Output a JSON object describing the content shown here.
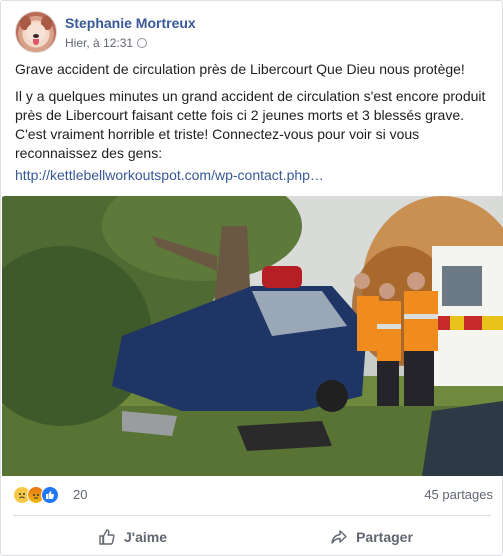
{
  "post": {
    "author": "Stephanie Mortreux",
    "timestamp": "Hier, à 12:31",
    "headline": "Grave accident de circulation près de Libercourt Que Dieu nous protège!",
    "body": "Il y a quelques minutes un grand accident de circulation s'est encore produit près de Libercourt faisant cette fois ci 2 jeunes morts et 3 blessés grave. C'est vraiment horrible et triste! Connectez-vous pour voir si vous reconnaissez des gens:",
    "link": "http://kettlebellworkoutspot.com/wp-contact.php…"
  },
  "stats": {
    "reactions": [
      "sad-react-icon",
      "angry-react-icon",
      "like-react-icon"
    ],
    "reaction_count": "20",
    "shares": "45 partages"
  },
  "actions": {
    "like_label": "J'aime",
    "share_label": "Partager"
  },
  "colors": {
    "link": "#385898",
    "author": "#385898",
    "muted": "#606770",
    "like_blue": "#2078f4"
  }
}
